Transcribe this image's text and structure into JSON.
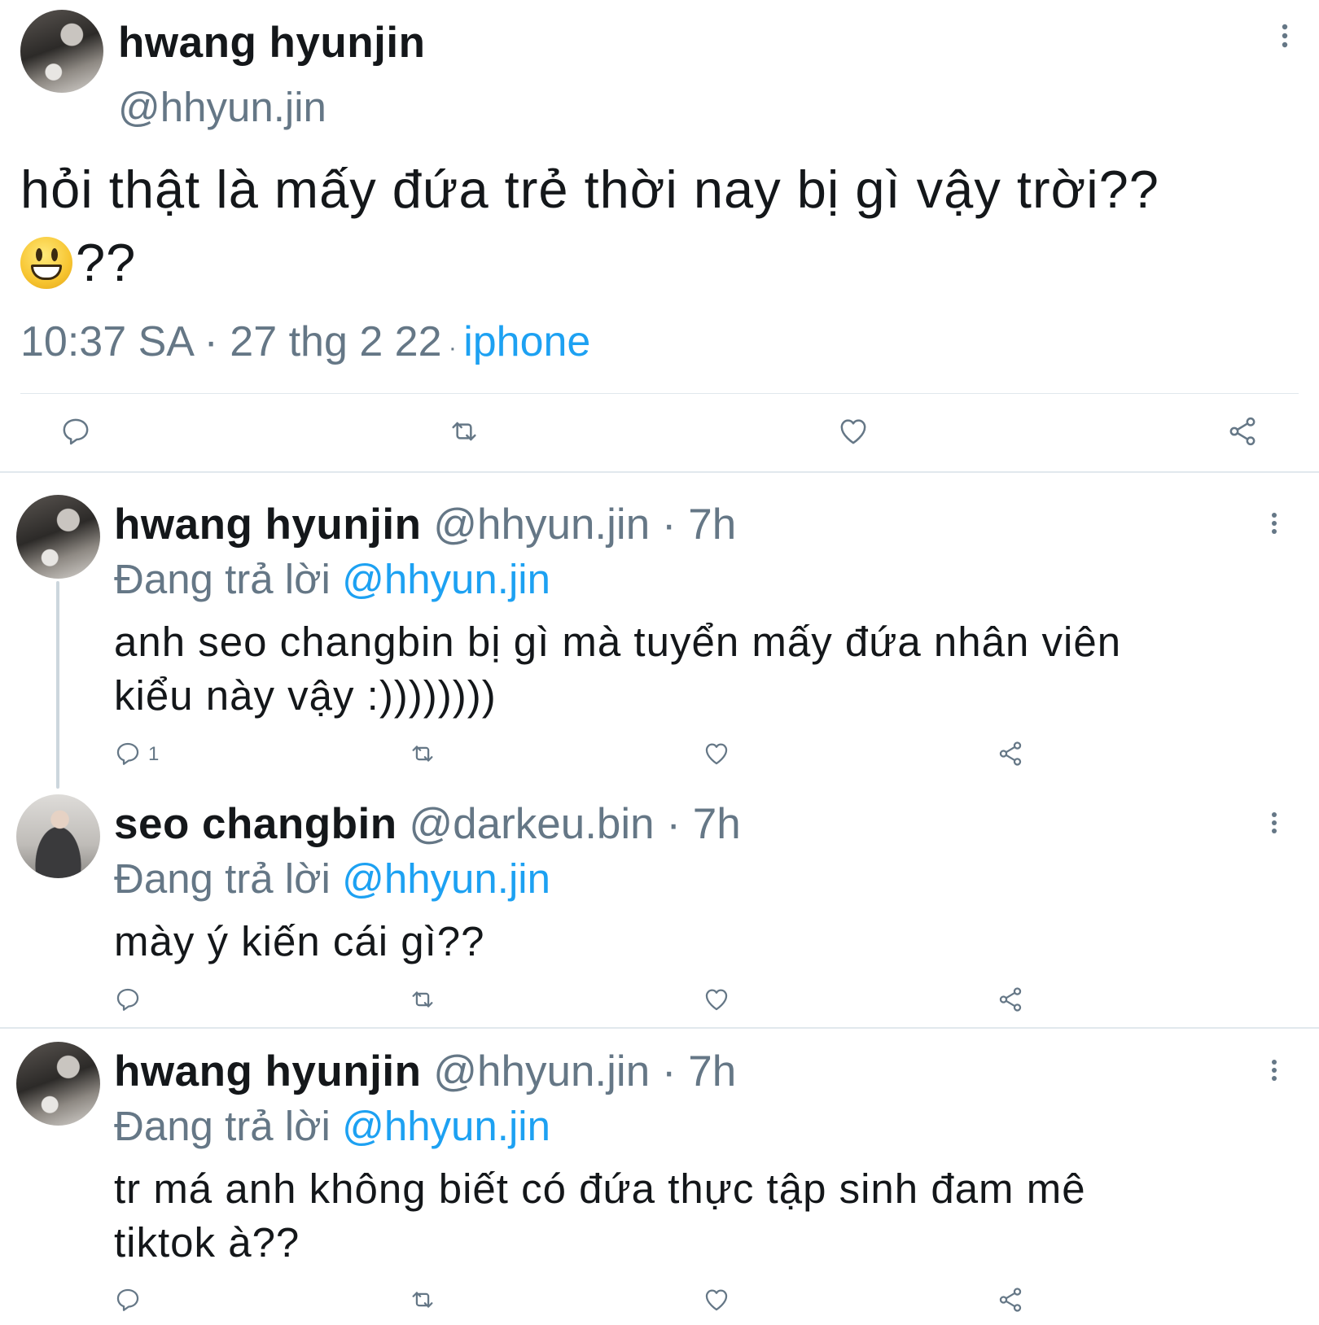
{
  "main_tweet": {
    "display_name": "hwang hyunjin",
    "handle": "@hhyun.jin",
    "text_line1": "hỏi thật là mấy đứa trẻ thời nay bị gì vậy trời??",
    "text_line2": "??",
    "time": "10:37 SA",
    "separator1": " · ",
    "date": "27 thg 2 22",
    "separator2": " · ",
    "source": "iphone"
  },
  "replies": [
    {
      "display_name": "hwang hyunjin",
      "handle": "@hhyun.jin",
      "separator": " · ",
      "time": "7h",
      "replying_label": "Đang trả lời ",
      "replying_to": "@hhyun.jin",
      "text_line1": "anh seo changbin bị gì mà tuyển mấy đứa nhân viên",
      "text_line2": "kiểu này vậy :))))))))",
      "reply_count": "1"
    },
    {
      "display_name": "seo changbin",
      "handle": "@darkeu.bin",
      "separator": " · ",
      "time": "7h",
      "replying_label": "Đang trả lời ",
      "replying_to": "@hhyun.jin",
      "text_line1": "mày ý kiến cái gì??",
      "text_line2": "",
      "reply_count": ""
    },
    {
      "display_name": "hwang hyunjin",
      "handle": "@hhyun.jin",
      "separator": " · ",
      "time": "7h",
      "replying_label": "Đang trả lời ",
      "replying_to": "@hhyun.jin",
      "text_line1": "tr má anh không biết có đứa thực tập sinh đam mê",
      "text_line2": "tiktok à??",
      "reply_count": ""
    }
  ],
  "icons": [
    "reply-icon",
    "retweet-icon",
    "like-icon",
    "share-icon",
    "more-options-icon",
    "smiley-emoji-icon"
  ],
  "colors": {
    "text": "#14171a",
    "secondary": "#657786",
    "link": "#1da1f2",
    "divider": "#e1e8ed"
  }
}
